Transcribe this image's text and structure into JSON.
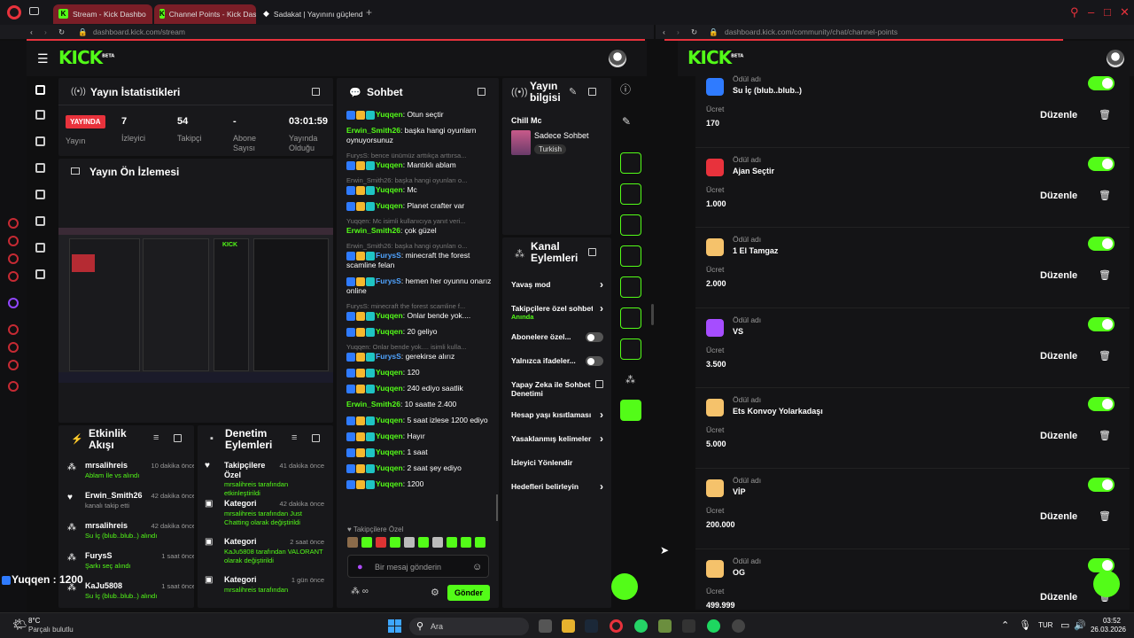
{
  "browser": {
    "tabs": [
      {
        "label": "Stream - Kick Dashbo"
      },
      {
        "label": "Channel Points - Kick Das"
      },
      {
        "label": "Sadakat | Yayınını güçlend"
      }
    ],
    "left_url": "dashboard.kick.com/stream",
    "right_url": "dashboard.kick.com/community/chat/channel-points"
  },
  "logo": "KICK",
  "logo_beta": "BETA",
  "stats": {
    "title": "Yayın İstatistikleri",
    "live_badge": "YAYINDA",
    "live_label": "Yayın",
    "viewers": "7",
    "viewers_label": "İzleyici",
    "followers": "54",
    "followers_label": "Takipçi",
    "subs": "-",
    "subs_label": "Abone Sayısı",
    "uptime": "03:01:59",
    "uptime_label": "Yayında Olduğu"
  },
  "preview": {
    "title": "Yayın Ön İzlemesi"
  },
  "activity": {
    "title": "Etkinlik Akışı",
    "items": [
      {
        "user": "mrsalihreis",
        "time": "10 dakika önce",
        "desc": "Ablam İle vs alındı"
      },
      {
        "user": "Erwin_Smith26",
        "time": "42 dakika önce",
        "desc": "kanalı takip etti"
      },
      {
        "user": "mrsalihreis",
        "time": "42 dakika önce",
        "desc": "Su İç (blub..blub..) alındı"
      },
      {
        "user": "FurysS",
        "time": "1 saat önce",
        "desc": "Şarkı seç alındı"
      },
      {
        "user": "KaJu5808",
        "time": "1 saat önce",
        "desc": "Su İç (blub..blub..) alındı"
      }
    ]
  },
  "moderation": {
    "title": "Denetim Eylemleri",
    "items": [
      {
        "title": "Takipçilere Özel",
        "time": "41 dakika önce",
        "desc": "mrsalihreis tarafından etkinleştirildi"
      },
      {
        "title": "Kategori",
        "time": "42 dakika önce",
        "desc": "mrsalihreis tarafından Just Chatting olarak değiştirildi"
      },
      {
        "title": "Kategori",
        "time": "2 saat önce",
        "desc": "KaJu5808 tarafından VALORANT olarak değiştirildi"
      },
      {
        "title": "Kategori",
        "time": "1 gün önce",
        "desc": "mrsalihreis tarafından"
      }
    ]
  },
  "chat": {
    "title": "Sohbet",
    "messages": [
      {
        "reply": "",
        "user": "Yuqqen",
        "text": "Otun seçtir",
        "cls": "u-y",
        "badges": true
      },
      {
        "reply": "",
        "user": "Erwin_Smith26",
        "text": "başka hangi oyunlarn oynuyorsunuz",
        "cls": "u-e",
        "badges": false
      },
      {
        "reply": "FurysS: bence ünümüz arttıkça arttırsa...",
        "user": "Yuqqen",
        "text": "Mantıklı ablam",
        "cls": "u-y",
        "badges": true
      },
      {
        "reply": "Erwin_Smith26: başka hangi oyunları o...",
        "user": "Yuqqen",
        "text": "Mc",
        "cls": "u-y",
        "badges": true
      },
      {
        "reply": "",
        "user": "Yuqqen",
        "text": "Planet crafter var",
        "cls": "u-y",
        "badges": true
      },
      {
        "reply": "Yuqqen: Mc isimli kullanıcıya yanıt veri...",
        "user": "Erwin_Smith26",
        "text": "çok güzel",
        "cls": "u-e",
        "badges": false
      },
      {
        "reply": "Erwin_Smith26: başka hangi oyunları o...",
        "user": "FurysS",
        "text": "minecraft the forest scamline felan",
        "cls": "u-f",
        "badges": true
      },
      {
        "reply": "",
        "user": "FurysS",
        "text": "hemen her oyunnu onarız online",
        "cls": "u-f",
        "badges": true
      },
      {
        "reply": "FurysS: minecraft the forest scamline f...",
        "user": "Yuqqen",
        "text": "Onlar bende yok....",
        "cls": "u-y",
        "badges": true
      },
      {
        "reply": "",
        "user": "Yuqqen",
        "text": "20 geliyo",
        "cls": "u-y",
        "badges": true
      },
      {
        "reply": "Yuqqen: Onlar bende yok.... isimli kulla...",
        "user": "FurysS",
        "text": "gerekirse alırız",
        "cls": "u-f",
        "badges": true
      },
      {
        "reply": "",
        "user": "Yuqqen",
        "text": "120",
        "cls": "u-y",
        "badges": true
      },
      {
        "reply": "",
        "user": "Yuqqen",
        "text": "240 ediyo saatlik",
        "cls": "u-y",
        "badges": true
      },
      {
        "reply": "",
        "user": "Erwin_Smith26",
        "text": "10 saatte 2.400",
        "cls": "u-e",
        "badges": false
      },
      {
        "reply": "",
        "user": "Yuqqen",
        "text": "5 saat izlese 1200 ediyo",
        "cls": "u-y",
        "badges": true
      },
      {
        "reply": "",
        "user": "Yuqqen",
        "text": "Hayır",
        "cls": "u-y",
        "badges": true
      },
      {
        "reply": "",
        "user": "Yuqqen",
        "text": "1 saat",
        "cls": "u-y",
        "badges": true
      },
      {
        "reply": "",
        "user": "Yuqqen",
        "text": "2 saat şey ediyo",
        "cls": "u-y",
        "badges": true
      },
      {
        "reply": "",
        "user": "Yuqqen",
        "text": "1200",
        "cls": "u-y",
        "badges": true
      }
    ],
    "mode_label": "Takipçilere Özel",
    "placeholder": "Bir mesaj gönderin",
    "send": "Gönder"
  },
  "stream_info": {
    "title": "Yayın bilgisi",
    "stream_title": "Chill Mc",
    "category": "Sadece Sohbet",
    "language": "Turkish"
  },
  "channel_actions": {
    "title": "Kanal Eylemleri",
    "items": [
      {
        "label": "Yavaş mod",
        "sub": "",
        "kind": "arrow"
      },
      {
        "label": "Takipçilere özel sohbet",
        "sub": "Anında",
        "kind": "arrow"
      },
      {
        "label": "Abonelere özel...",
        "sub": "",
        "kind": "toggle"
      },
      {
        "label": "Yalnızca ifadeler...",
        "sub": "",
        "kind": "toggle"
      },
      {
        "label": "Yapay Zeka ile Sohbet Denetimi",
        "sub": "",
        "kind": "ext"
      },
      {
        "label": "Hesap yaşı kısıtlaması",
        "sub": "",
        "kind": "arrow"
      },
      {
        "label": "Yasaklanmış kelimeler",
        "sub": "",
        "kind": "arrow"
      },
      {
        "label": "İzleyici Yönlendir",
        "sub": "",
        "kind": "none"
      },
      {
        "label": "Hedefleri belirleyin",
        "sub": "",
        "kind": "arrow"
      }
    ]
  },
  "rewards": {
    "name_label": "Ödül adı",
    "cost_label": "Ücret",
    "edit_label": "Düzenle",
    "items": [
      {
        "name": "Su İç (blub..blub..)",
        "cost": "170",
        "color": "#2f7bff"
      },
      {
        "name": "Ajan Seçtir",
        "cost": "1.000",
        "color": "#e8323c"
      },
      {
        "name": "1 El Tamgaz",
        "cost": "2.000",
        "color": "#f5c26b"
      },
      {
        "name": "VS",
        "cost": "3.500",
        "color": "#a64dff"
      },
      {
        "name": "Ets Konvoy Yolarkadaşı",
        "cost": "5.000",
        "color": "#f5c26b"
      },
      {
        "name": "VİP",
        "cost": "200.000",
        "color": "#f5c26b"
      },
      {
        "name": "OG",
        "cost": "499.999",
        "color": "#f5c26b"
      }
    ]
  },
  "overlay_text": "Yuqqen : 1200",
  "taskbar": {
    "weather_temp": "8°C",
    "weather_desc": "Parçalı bulutlu",
    "search": "Ara",
    "lang": "TUR",
    "time": "03:52",
    "date": "26.03.2026"
  }
}
